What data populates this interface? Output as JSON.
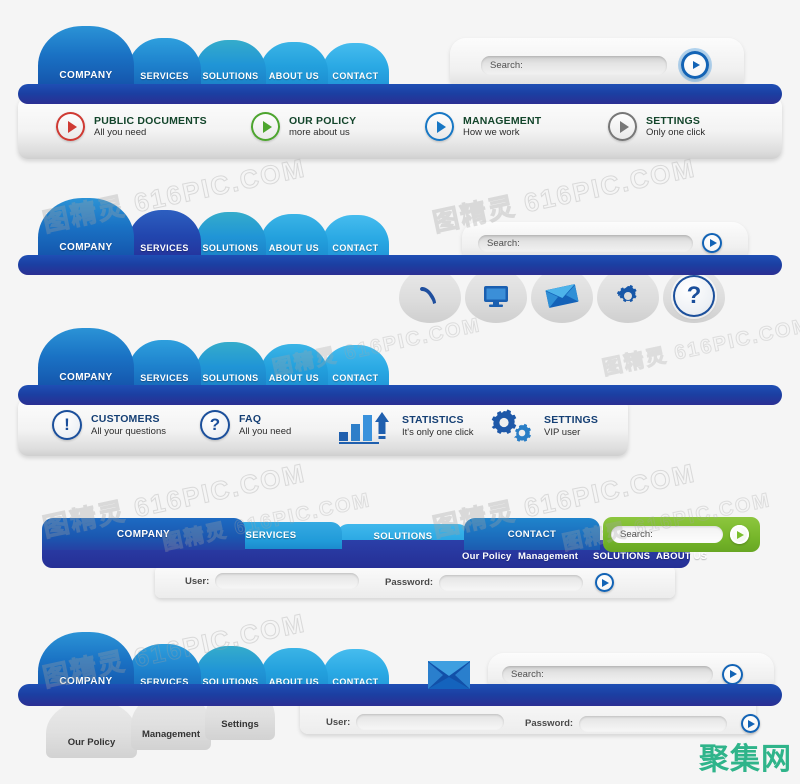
{
  "watermarks": {
    "tile": "图精灵  616PIC.COM",
    "brand": "聚集网"
  },
  "palette": {
    "deep_blue": "#1f4fb4",
    "indigo": "#2b2f93",
    "sky": "#2aa8e0",
    "light_sky": "#35b4e8",
    "green": "#7bbf2e",
    "red": "#cf3a33",
    "leaf_green": "#4da52f",
    "gray": "#777777",
    "title_green": "#13452b",
    "watermark_teal": "#2fb48a"
  },
  "navbar1": {
    "tabs": [
      {
        "label": "COMPANY",
        "active": true
      },
      {
        "label": "SERVICES",
        "active": false
      },
      {
        "label": "SOLUTIONS",
        "active": false
      },
      {
        "label": "ABOUT US",
        "active": false
      },
      {
        "label": "CONTACT",
        "active": false
      }
    ],
    "search": {
      "label": "Search:",
      "value": "",
      "go_icon": "play-icon"
    },
    "features": [
      {
        "title": "PUBLIC DOCUMENTS",
        "subtitle": "All you need",
        "icon": "play-circle-icon",
        "color": "red"
      },
      {
        "title": "OUR POLICY",
        "subtitle": "more about us",
        "icon": "play-circle-icon",
        "color": "green"
      },
      {
        "title": "MANAGEMENT",
        "subtitle": "How we work",
        "icon": "play-circle-icon",
        "color": "blue"
      },
      {
        "title": "SETTINGS",
        "subtitle": "Only one click",
        "icon": "play-circle-icon",
        "color": "gray"
      }
    ]
  },
  "navbar2": {
    "tabs": [
      {
        "label": "COMPANY",
        "active": false
      },
      {
        "label": "SERVICES",
        "active": true
      },
      {
        "label": "SOLUTIONS",
        "active": false
      },
      {
        "label": "ABOUT US",
        "active": false
      },
      {
        "label": "CONTACT",
        "active": false
      }
    ],
    "search": {
      "label": "Search:",
      "value": "",
      "go_icon": "play-icon"
    },
    "icons": [
      {
        "name": "phone-icon"
      },
      {
        "name": "monitor-icon"
      },
      {
        "name": "envelope-icon"
      },
      {
        "name": "gear-icon"
      },
      {
        "name": "question-icon",
        "glyph": "?"
      }
    ]
  },
  "navbar3": {
    "tabs": [
      {
        "label": "COMPANY",
        "active": true
      },
      {
        "label": "SERVICES",
        "active": false
      },
      {
        "label": "SOLUTIONS",
        "active": false
      },
      {
        "label": "ABOUT US",
        "active": false
      },
      {
        "label": "CONTACT",
        "active": false
      }
    ],
    "features": [
      {
        "title": "CUSTOMERS",
        "subtitle": "All your questions",
        "icon": "exclamation-circle-icon",
        "glyph": "!"
      },
      {
        "title": "FAQ",
        "subtitle": "All you need",
        "icon": "question-circle-icon",
        "glyph": "?"
      },
      {
        "title": "STATISTICS",
        "subtitle": "It's only one click",
        "icon": "bar-chart-icon"
      },
      {
        "title": "SETTINGS",
        "subtitle": "VIP user",
        "icon": "gears-icon"
      }
    ]
  },
  "navbar4": {
    "tabs": [
      {
        "label": "COMPANY",
        "active": true
      },
      {
        "label": "SERVICES",
        "active": false
      },
      {
        "label": "SOLUTIONS",
        "active": false
      },
      {
        "label": "CONTACT",
        "active": false
      }
    ],
    "search": {
      "label": "Search:",
      "value": "",
      "go_icon": "play-icon"
    },
    "submenu": [
      {
        "label": "Our Policy"
      },
      {
        "label": "Management"
      },
      {
        "label": "SOLUTIONS"
      },
      {
        "label": "ABOUT US"
      }
    ],
    "login": {
      "user_label": "User:",
      "user_value": "",
      "password_label": "Password:",
      "password_value": "",
      "go_icon": "play-icon"
    }
  },
  "navbar5": {
    "tabs": [
      {
        "label": "COMPANY",
        "active": true
      },
      {
        "label": "SERVICES",
        "active": false
      },
      {
        "label": "SOLUTIONS",
        "active": false
      },
      {
        "label": "ABOUT US",
        "active": false
      },
      {
        "label": "CONTACT",
        "active": false
      }
    ],
    "mail_icon": "envelope-icon",
    "search": {
      "label": "Search:",
      "value": "",
      "go_icon": "play-icon"
    },
    "subtabs": [
      {
        "label": "Our Policy"
      },
      {
        "label": "Management"
      },
      {
        "label": "Settings"
      }
    ],
    "login": {
      "user_label": "User:",
      "user_value": "",
      "password_label": "Password:",
      "password_value": "",
      "go_icon": "play-icon"
    }
  }
}
